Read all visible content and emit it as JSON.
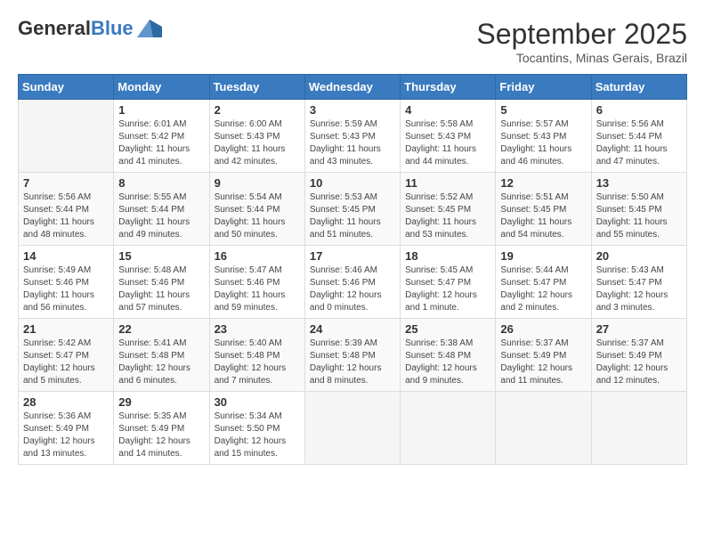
{
  "header": {
    "logo_general": "General",
    "logo_blue": "Blue",
    "month_title": "September 2025",
    "subtitle": "Tocantins, Minas Gerais, Brazil"
  },
  "days_of_week": [
    "Sunday",
    "Monday",
    "Tuesday",
    "Wednesday",
    "Thursday",
    "Friday",
    "Saturday"
  ],
  "weeks": [
    [
      {
        "day": "",
        "info": ""
      },
      {
        "day": "1",
        "info": "Sunrise: 6:01 AM\nSunset: 5:42 PM\nDaylight: 11 hours\nand 41 minutes."
      },
      {
        "day": "2",
        "info": "Sunrise: 6:00 AM\nSunset: 5:43 PM\nDaylight: 11 hours\nand 42 minutes."
      },
      {
        "day": "3",
        "info": "Sunrise: 5:59 AM\nSunset: 5:43 PM\nDaylight: 11 hours\nand 43 minutes."
      },
      {
        "day": "4",
        "info": "Sunrise: 5:58 AM\nSunset: 5:43 PM\nDaylight: 11 hours\nand 44 minutes."
      },
      {
        "day": "5",
        "info": "Sunrise: 5:57 AM\nSunset: 5:43 PM\nDaylight: 11 hours\nand 46 minutes."
      },
      {
        "day": "6",
        "info": "Sunrise: 5:56 AM\nSunset: 5:44 PM\nDaylight: 11 hours\nand 47 minutes."
      }
    ],
    [
      {
        "day": "7",
        "info": "Sunrise: 5:56 AM\nSunset: 5:44 PM\nDaylight: 11 hours\nand 48 minutes."
      },
      {
        "day": "8",
        "info": "Sunrise: 5:55 AM\nSunset: 5:44 PM\nDaylight: 11 hours\nand 49 minutes."
      },
      {
        "day": "9",
        "info": "Sunrise: 5:54 AM\nSunset: 5:44 PM\nDaylight: 11 hours\nand 50 minutes."
      },
      {
        "day": "10",
        "info": "Sunrise: 5:53 AM\nSunset: 5:45 PM\nDaylight: 11 hours\nand 51 minutes."
      },
      {
        "day": "11",
        "info": "Sunrise: 5:52 AM\nSunset: 5:45 PM\nDaylight: 11 hours\nand 53 minutes."
      },
      {
        "day": "12",
        "info": "Sunrise: 5:51 AM\nSunset: 5:45 PM\nDaylight: 11 hours\nand 54 minutes."
      },
      {
        "day": "13",
        "info": "Sunrise: 5:50 AM\nSunset: 5:45 PM\nDaylight: 11 hours\nand 55 minutes."
      }
    ],
    [
      {
        "day": "14",
        "info": "Sunrise: 5:49 AM\nSunset: 5:46 PM\nDaylight: 11 hours\nand 56 minutes."
      },
      {
        "day": "15",
        "info": "Sunrise: 5:48 AM\nSunset: 5:46 PM\nDaylight: 11 hours\nand 57 minutes."
      },
      {
        "day": "16",
        "info": "Sunrise: 5:47 AM\nSunset: 5:46 PM\nDaylight: 11 hours\nand 59 minutes."
      },
      {
        "day": "17",
        "info": "Sunrise: 5:46 AM\nSunset: 5:46 PM\nDaylight: 12 hours\nand 0 minutes."
      },
      {
        "day": "18",
        "info": "Sunrise: 5:45 AM\nSunset: 5:47 PM\nDaylight: 12 hours\nand 1 minute."
      },
      {
        "day": "19",
        "info": "Sunrise: 5:44 AM\nSunset: 5:47 PM\nDaylight: 12 hours\nand 2 minutes."
      },
      {
        "day": "20",
        "info": "Sunrise: 5:43 AM\nSunset: 5:47 PM\nDaylight: 12 hours\nand 3 minutes."
      }
    ],
    [
      {
        "day": "21",
        "info": "Sunrise: 5:42 AM\nSunset: 5:47 PM\nDaylight: 12 hours\nand 5 minutes."
      },
      {
        "day": "22",
        "info": "Sunrise: 5:41 AM\nSunset: 5:48 PM\nDaylight: 12 hours\nand 6 minutes."
      },
      {
        "day": "23",
        "info": "Sunrise: 5:40 AM\nSunset: 5:48 PM\nDaylight: 12 hours\nand 7 minutes."
      },
      {
        "day": "24",
        "info": "Sunrise: 5:39 AM\nSunset: 5:48 PM\nDaylight: 12 hours\nand 8 minutes."
      },
      {
        "day": "25",
        "info": "Sunrise: 5:38 AM\nSunset: 5:48 PM\nDaylight: 12 hours\nand 9 minutes."
      },
      {
        "day": "26",
        "info": "Sunrise: 5:37 AM\nSunset: 5:49 PM\nDaylight: 12 hours\nand 11 minutes."
      },
      {
        "day": "27",
        "info": "Sunrise: 5:37 AM\nSunset: 5:49 PM\nDaylight: 12 hours\nand 12 minutes."
      }
    ],
    [
      {
        "day": "28",
        "info": "Sunrise: 5:36 AM\nSunset: 5:49 PM\nDaylight: 12 hours\nand 13 minutes."
      },
      {
        "day": "29",
        "info": "Sunrise: 5:35 AM\nSunset: 5:49 PM\nDaylight: 12 hours\nand 14 minutes."
      },
      {
        "day": "30",
        "info": "Sunrise: 5:34 AM\nSunset: 5:50 PM\nDaylight: 12 hours\nand 15 minutes."
      },
      {
        "day": "",
        "info": ""
      },
      {
        "day": "",
        "info": ""
      },
      {
        "day": "",
        "info": ""
      },
      {
        "day": "",
        "info": ""
      }
    ]
  ]
}
